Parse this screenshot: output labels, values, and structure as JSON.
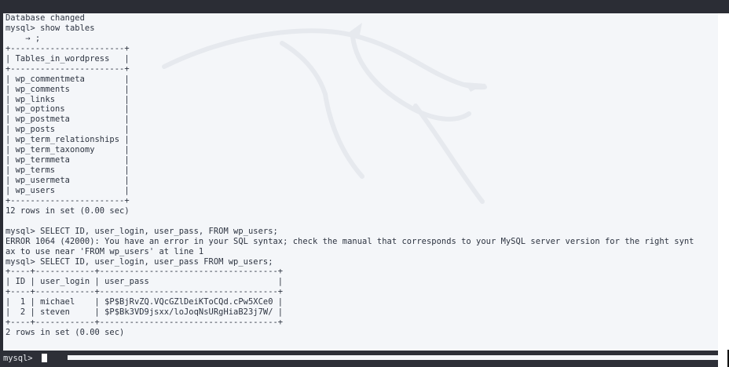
{
  "terminal": {
    "lines": [
      "Database changed",
      "mysql> show tables",
      "    → ;",
      "+-----------------------+",
      "| Tables_in_wordpress   |",
      "+-----------------------+",
      "| wp_commentmeta        |",
      "| wp_comments           |",
      "| wp_links              |",
      "| wp_options            |",
      "| wp_postmeta           |",
      "| wp_posts              |",
      "| wp_term_relationships |",
      "| wp_term_taxonomy      |",
      "| wp_termmeta           |",
      "| wp_terms              |",
      "| wp_usermeta           |",
      "| wp_users              |",
      "+-----------------------+",
      "12 rows in set (0.00 sec)",
      "",
      "mysql> SELECT ID, user_login, user_pass, FROM wp_users;",
      "ERROR 1064 (42000): You have an error in your SQL syntax; check the manual that corresponds to your MySQL server version for the right synt",
      "ax to use near 'FROM wp_users' at line 1",
      "mysql> SELECT ID, user_login, user_pass FROM wp_users;",
      "+----+------------+------------------------------------+",
      "| ID | user_login | user_pass                          |",
      "+----+------------+------------------------------------+",
      "|  1 | michael    | $P$BjRvZQ.VQcGZlDeiKToCQd.cPw5XCe0 |",
      "|  2 | steven     | $P$Bk3VD9jsxx/loJoqNsURgHiaB23j7W/ |",
      "+----+------------+------------------------------------+",
      "2 rows in set (0.00 sec)"
    ],
    "prompt": "mysql> "
  },
  "colors": {
    "terminal_bg": "#f4f6f9",
    "text": "#2c3340",
    "chrome": "#2a2c34",
    "watermark": "#e6e9ee"
  },
  "icons": {
    "watermark": "kali-dragon-icon"
  }
}
